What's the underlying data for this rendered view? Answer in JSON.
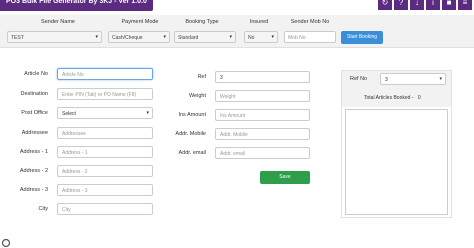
{
  "window": {
    "title": "PO3 Bulk File Generator By 3KJ - Ver 1.0.0",
    "controls": [
      "↻",
      "?",
      "↓",
      "i",
      "■",
      "≡"
    ]
  },
  "topbar": {
    "sender_name": {
      "label": "Sender Name",
      "value": "TEST"
    },
    "payment_mode": {
      "label": "Payment Mode",
      "value": "Cash/Cheque"
    },
    "booking_type": {
      "label": "Booking Type",
      "value": "Standard"
    },
    "insured": {
      "label": "Insured",
      "value": "No"
    },
    "sender_mob": {
      "label": "Sender Mob No",
      "placeholder": "Mob No"
    },
    "start_booking": "Start Booking"
  },
  "form": {
    "article_no": {
      "label": "Article No",
      "placeholder": "Article No"
    },
    "destination": {
      "label": "Destination",
      "placeholder": "Enter PIN (Tab) or PO Name (F8)"
    },
    "post_office": {
      "label": "Post Office",
      "value": "Select"
    },
    "addressee": {
      "label": "Addressee",
      "placeholder": "Addressee"
    },
    "address1": {
      "label": "Address - 1",
      "placeholder": "Address - 1"
    },
    "address2": {
      "label": "Address - 2",
      "placeholder": "Address - 2"
    },
    "address3": {
      "label": "Address - 3",
      "placeholder": "Address - 3"
    },
    "city": {
      "label": "City",
      "placeholder": "City"
    },
    "ref": {
      "label": "Ref",
      "value": "3"
    },
    "weight": {
      "label": "Weight",
      "placeholder": "Weight"
    },
    "ins_amount": {
      "label": "Ins Amount",
      "placeholder": "Ins Amount"
    },
    "addr_mobile": {
      "label": "Addr. Mobile",
      "placeholder": "Addr. Mobile"
    },
    "addr_email": {
      "label": "Addr. email",
      "placeholder": "Addr. email"
    },
    "save": "Save"
  },
  "panel": {
    "ref_label": "Ref No",
    "ref_value": "3",
    "total_label": "Total Articles Booked -",
    "total_value": "0"
  }
}
